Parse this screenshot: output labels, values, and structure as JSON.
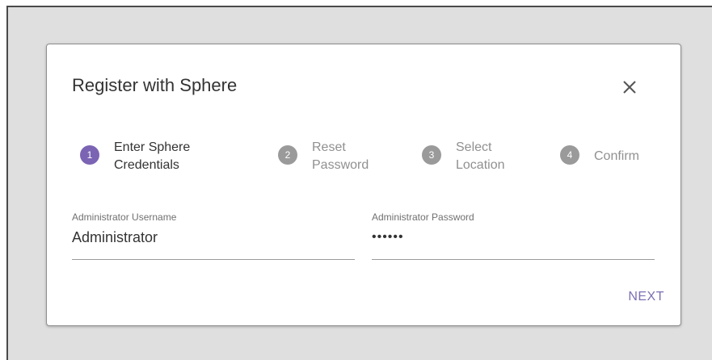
{
  "dialog": {
    "title": "Register with Sphere",
    "close_icon": "close-icon"
  },
  "steps": [
    {
      "number": "1",
      "label_line1": "Enter Sphere",
      "label_line2": "Credentials",
      "state": "active"
    },
    {
      "number": "2",
      "label_line1": "Reset",
      "label_line2": "Password",
      "state": "inactive"
    },
    {
      "number": "3",
      "label_line1": "Select",
      "label_line2": "Location",
      "state": "inactive"
    },
    {
      "number": "4",
      "label_line1": "Confirm",
      "label_line2": "",
      "state": "inactive"
    }
  ],
  "form": {
    "username": {
      "label": "Administrator Username",
      "value": "Administrator"
    },
    "password": {
      "label": "Administrator Password",
      "value": "••••••"
    }
  },
  "actions": {
    "next_label": "NEXT"
  },
  "colors": {
    "accent": "#7d6fb3",
    "step_active": "#7b64b3",
    "step_inactive": "#9a9a9a",
    "backdrop": "#dfdfdf"
  }
}
